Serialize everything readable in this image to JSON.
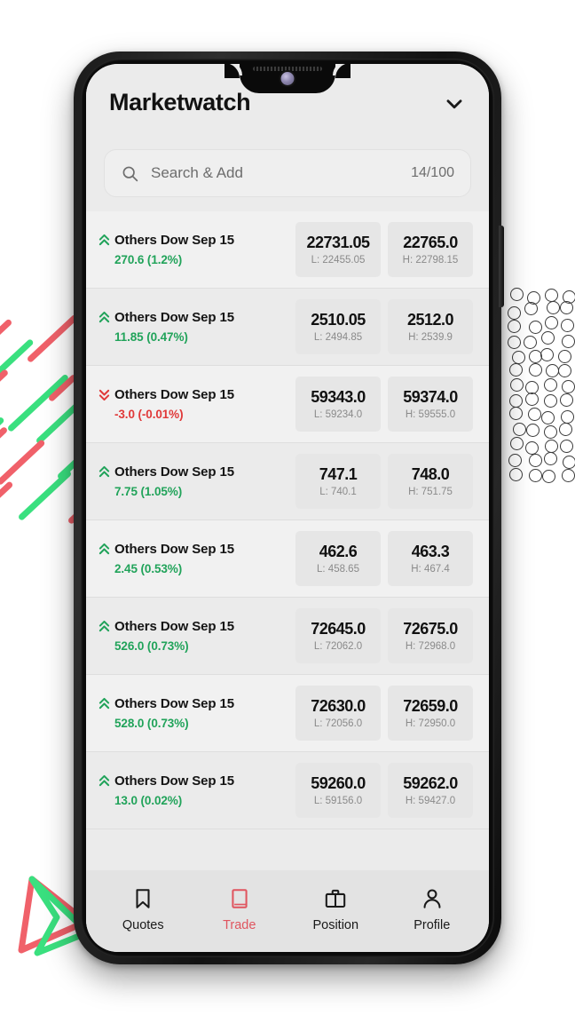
{
  "colors": {
    "accent_red": "#e0555f",
    "up_green": "#21a35a",
    "down_red": "#e03a3a",
    "screen_bg": "#ebebeb",
    "row_alt_bg": "#f1f1f1",
    "value_box_bg": "#e6e6e6",
    "title_text": "#121212",
    "muted_text": "#6d6d6d"
  },
  "header": {
    "title": "Marketwatch",
    "dropdown_icon": "chevron-down-icon"
  },
  "search": {
    "icon": "search-icon",
    "placeholder": "Search & Add",
    "value": "",
    "count": "14/100"
  },
  "instruments": [
    {
      "direction": "up",
      "direction_icon": "double-chevron-up-icon",
      "symbol": "Others Dow Sep 15",
      "change": "270.6 (1.2%)",
      "bid": "22731.05",
      "low": "L: 22455.05",
      "ask": "22765.0",
      "high": "H: 22798.15"
    },
    {
      "direction": "up",
      "direction_icon": "double-chevron-up-icon",
      "symbol": "Others Dow Sep 15",
      "change": "11.85 (0.47%)",
      "bid": "2510.05",
      "low": "L: 2494.85",
      "ask": "2512.0",
      "high": "H: 2539.9"
    },
    {
      "direction": "down",
      "direction_icon": "double-chevron-down-icon",
      "symbol": "Others Dow Sep 15",
      "change": "-3.0 (-0.01%)",
      "bid": "59343.0",
      "low": "L: 59234.0",
      "ask": "59374.0",
      "high": "H: 59555.0"
    },
    {
      "direction": "up",
      "direction_icon": "double-chevron-up-icon",
      "symbol": "Others Dow Sep 15",
      "change": "7.75 (1.05%)",
      "bid": "747.1",
      "low": "L: 740.1",
      "ask": "748.0",
      "high": "H: 751.75"
    },
    {
      "direction": "up",
      "direction_icon": "double-chevron-up-icon",
      "symbol": "Others Dow Sep 15",
      "change": "2.45 (0.53%)",
      "bid": "462.6",
      "low": "L: 458.65",
      "ask": "463.3",
      "high": "H: 467.4"
    },
    {
      "direction": "up",
      "direction_icon": "double-chevron-up-icon",
      "symbol": "Others Dow Sep 15",
      "change": "526.0 (0.73%)",
      "bid": "72645.0",
      "low": "L: 72062.0",
      "ask": "72675.0",
      "high": "H: 72968.0"
    },
    {
      "direction": "up",
      "direction_icon": "double-chevron-up-icon",
      "symbol": "Others Dow Sep 15",
      "change": "528.0 (0.73%)",
      "bid": "72630.0",
      "low": "L: 72056.0",
      "ask": "72659.0",
      "high": "H: 72950.0"
    },
    {
      "direction": "up",
      "direction_icon": "double-chevron-up-icon",
      "symbol": "Others Dow Sep 15",
      "change": "13.0 (0.02%)",
      "bid": "59260.0",
      "low": "L: 59156.0",
      "ask": "59262.0",
      "high": "H: 59427.0"
    }
  ],
  "bottom_nav": {
    "items": [
      {
        "label": "Quotes",
        "icon": "bookmark-icon",
        "active": false
      },
      {
        "label": "Trade",
        "icon": "book-icon",
        "active": true
      },
      {
        "label": "Position",
        "icon": "briefcase-icon",
        "active": false
      },
      {
        "label": "Profile",
        "icon": "person-icon",
        "active": false
      }
    ]
  }
}
